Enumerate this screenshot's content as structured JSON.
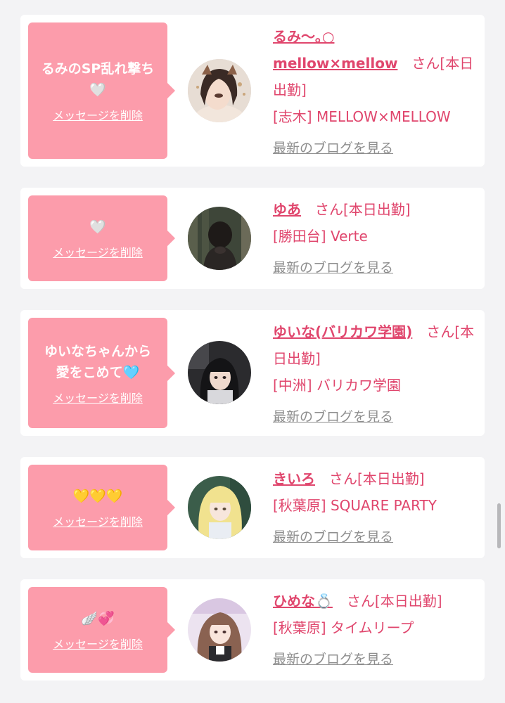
{
  "delete_label": "メッセージを削除",
  "blog_label": "最新のブログを見る",
  "cards": [
    {
      "message": "るみのSP乱れ撃ち\n🤍",
      "name_line1": "るみ〜｡○",
      "name_line2": "mellow×mellow",
      "san": "さん[本日出勤]",
      "shop": "[志木] MELLOW×MELLOW"
    },
    {
      "message": "🤍",
      "name": "ゆあ",
      "san": "さん[本日出勤]",
      "shop": "[勝田台] Verte"
    },
    {
      "message": "ゆいなちゃんから\n愛をこめて🩵",
      "name": "ゆいな(バリカワ学園)",
      "san": "さん[本日出勤]",
      "shop": "[中洲] バリカワ学園"
    },
    {
      "message": "💛💛💛",
      "name": "きいろ",
      "san": "さん[本日出勤]",
      "shop": "[秋葉原] SQUARE PARTY"
    },
    {
      "message": "🪽💞",
      "name": "ひめな💍",
      "san": "さん[本日出勤]",
      "shop": "[秋葉原] タイムリープ"
    }
  ]
}
